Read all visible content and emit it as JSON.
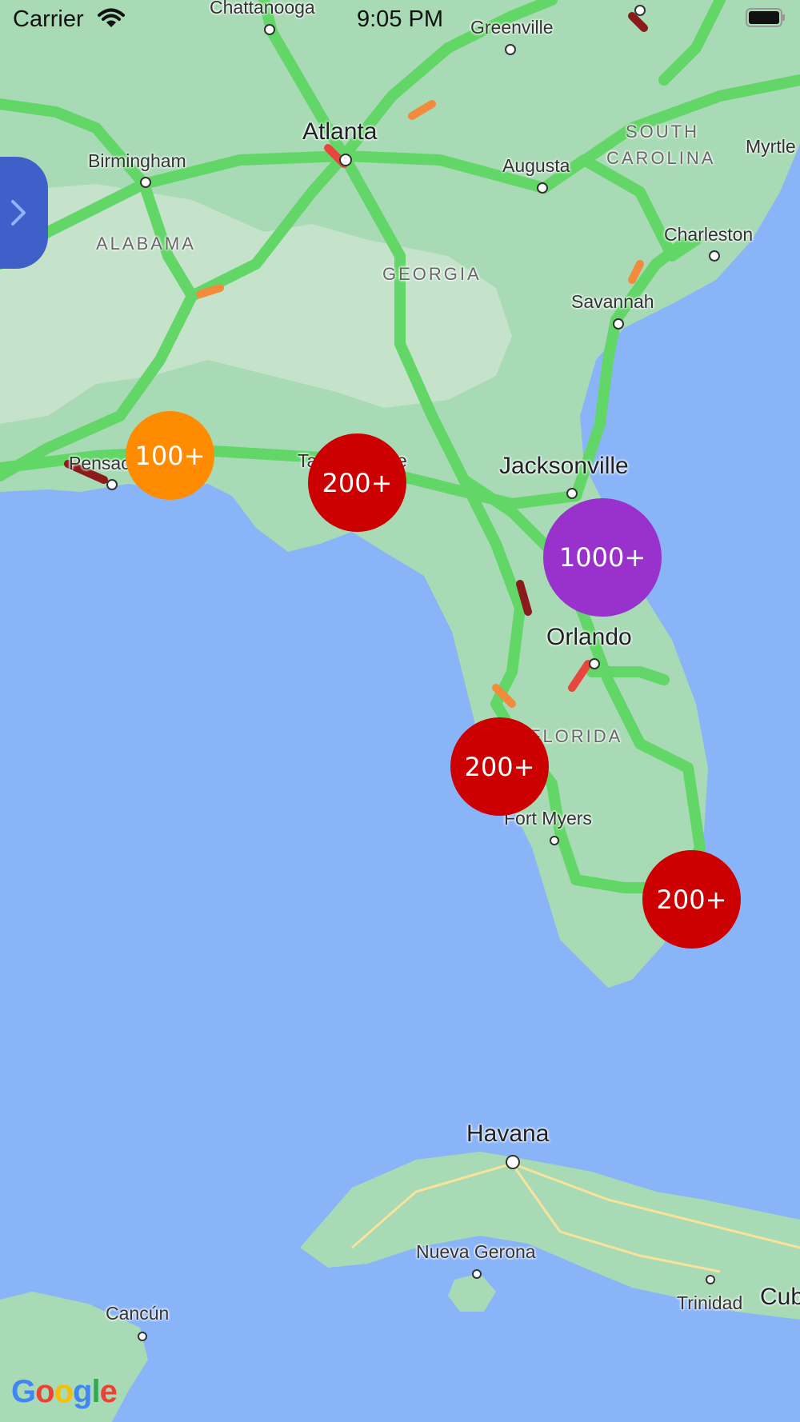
{
  "status_bar": {
    "carrier": "Carrier",
    "time": "9:05 PM"
  },
  "map": {
    "city_labels": [
      "Chattanooga",
      "Greenville",
      "Atlanta",
      "Birmingham",
      "Augusta",
      "Charleston",
      "Savannah",
      "Jacksonville",
      "Orlando",
      "Fort Myers",
      "Havana",
      "Nueva Gerona",
      "Cancún",
      "Trinidad",
      "Myrtle",
      "Pensac",
      "Ta",
      "e",
      "Cub"
    ],
    "state_labels": [
      "SOUTH",
      "CAROLINA",
      "ALABAMA",
      "GEORGIA",
      "FLORIDA"
    ],
    "clusters": [
      {
        "label": "100+",
        "color": "#ff8c00"
      },
      {
        "label": "200+",
        "color": "#cc0000"
      },
      {
        "label": "1000+",
        "color": "#9932cc"
      },
      {
        "label": "200+",
        "color": "#cc0000"
      },
      {
        "label": "200+",
        "color": "#cc0000"
      }
    ],
    "attribution": "Google"
  },
  "colors": {
    "water": "#8ab4f8",
    "land": "#a8dab5",
    "road": "#63d668",
    "side_tab": "#3f5fc9"
  }
}
